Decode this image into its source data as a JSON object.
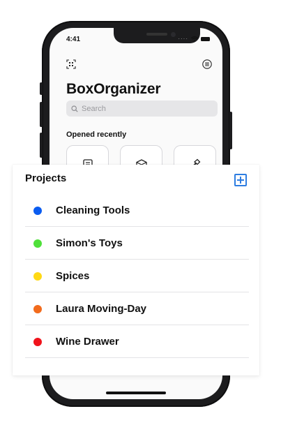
{
  "status_bar": {
    "time": "4:41"
  },
  "header": {
    "scan_icon": "scan-icon",
    "menu_icon": "menu-icon",
    "title": "BoxOrganizer"
  },
  "search": {
    "placeholder": "Search",
    "value": ""
  },
  "recent": {
    "title": "Opened recently",
    "tiles": [
      {
        "icon": "notebook-icon"
      },
      {
        "icon": "box-icon"
      },
      {
        "icon": "hammer-icon"
      }
    ]
  },
  "projects": {
    "title": "Projects",
    "add_icon": "plus-square-icon",
    "accent_color": "#2e7de1",
    "items": [
      {
        "label": "Cleaning Tools",
        "color": "#0a5cf0"
      },
      {
        "label": "Simon's Toys",
        "color": "#4fe03a"
      },
      {
        "label": "Spices",
        "color": "#ffd915"
      },
      {
        "label": "Laura Moving-Day",
        "color": "#f26b1d"
      },
      {
        "label": "Wine Drawer",
        "color": "#f0131b"
      }
    ]
  }
}
